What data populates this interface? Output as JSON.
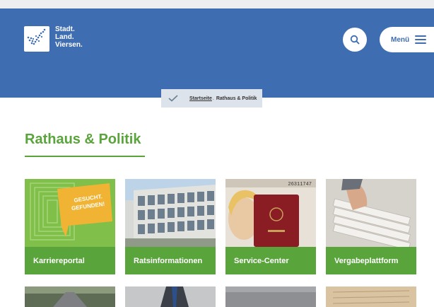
{
  "header": {
    "logo_line1": "Stadt.",
    "logo_line2": "Land.",
    "logo_line3": "Viersen.",
    "menu_label": "Menü",
    "brand_color": "#3f6db1"
  },
  "breadcrumb": {
    "home_label": "Startseite",
    "separator": ".",
    "current_label": "Rathaus & Politik"
  },
  "page": {
    "title": "Rathaus & Politik",
    "accent_color": "#5aa43c"
  },
  "tiles": [
    {
      "label": "Karriereportal",
      "badge_line1": "GESUCHT.",
      "badge_line2": "GEFUNDEN!"
    },
    {
      "label": "Ratsinformationen"
    },
    {
      "label": "Service-Center",
      "passport_number": "26311747"
    },
    {
      "label": "Vergabeplattform"
    }
  ],
  "icons": {
    "search": "search-icon",
    "menu": "hamburger-menu-icon",
    "home": "home-check-icon",
    "logo": "checkmark-logo-icon"
  }
}
